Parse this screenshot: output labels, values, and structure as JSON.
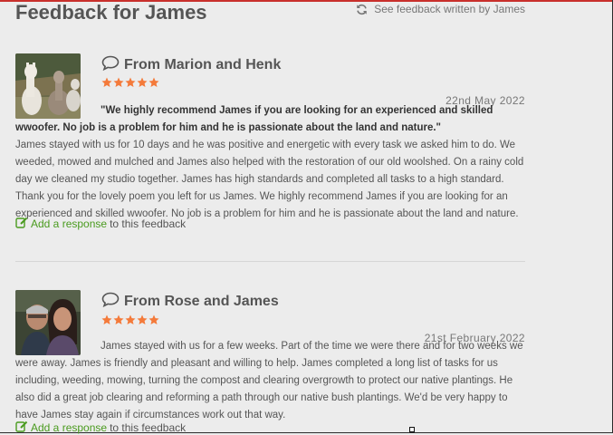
{
  "header": {
    "title": "Feedback for James",
    "see_feedback_label": "See feedback written by James"
  },
  "reviews": [
    {
      "from": "From Marion and Henk",
      "rating": 5,
      "date": "22nd May 2022",
      "quote": "\"We highly recommend James if you are looking for an experienced and skilled wwoofer. No job is a problem for him and he is passionate about the land and nature.\"",
      "body": "James stayed with us for 10 days and he was positive and energetic with every task we asked him to do. We weeded, mowed and mulched and James also helped with the restoration of our old woolshed. On a rainy cold day we cleaned my studio together. James has high standards and completed all tasks to a high standard. Thank you for the lovely poem you left for us James. We highly recommend James if you are looking for an experienced and skilled wwoofer. No job is a problem for him and he is passionate about the land and nature.",
      "response_link": "Add a response",
      "response_suffix": "to this feedback"
    },
    {
      "from": "From Rose and James",
      "rating": 5,
      "date": "21st February 2022",
      "body": "James stayed with us for a few weeks. Part of the time we were there and for two weeks we were away. James is friendly and pleasant and willing to help. James completed a long list of tasks for us including, weeding, mowing, turning the compost and clearing overgrowth to protect our native plantings. He also did a great job clearing and reforming a path through our native bush plantings. We'd be very happy to have James stay again if circumstances work out that way.",
      "response_link": "Add a response",
      "response_suffix": "to this feedback"
    }
  ],
  "colors": {
    "star": "#f47a3a",
    "link": "#4a9b1f",
    "accent_top": "#c9302c"
  },
  "icons": {
    "refresh": "refresh-icon",
    "comment": "comment-icon",
    "edit": "edit-icon",
    "star": "star-icon"
  }
}
